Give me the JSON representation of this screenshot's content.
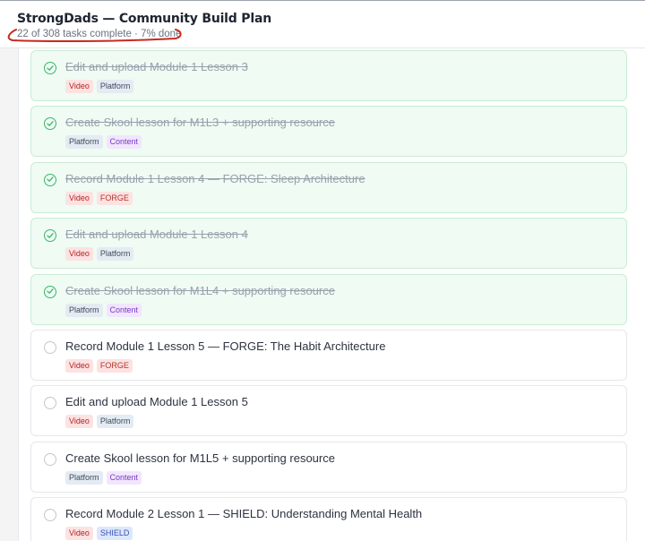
{
  "header": {
    "title": "StrongDads — Community Build Plan",
    "progress_text": "22 of 308 tasks complete · 7% done",
    "tasks_complete": 22,
    "tasks_total": 308,
    "percent_done": 7
  },
  "colors": {
    "done_background": "#effbf3",
    "check_green": "#3bb56c",
    "annotation_red": "#c62a1e"
  },
  "tasks": [
    {
      "title": "Edit and upload Module 1 Lesson 3",
      "done": true,
      "tags": [
        {
          "label": "Video",
          "kind": "video"
        },
        {
          "label": "Platform",
          "kind": "platform"
        }
      ]
    },
    {
      "title": "Create Skool lesson for M1L3 + supporting resource",
      "done": true,
      "tags": [
        {
          "label": "Platform",
          "kind": "platform"
        },
        {
          "label": "Content",
          "kind": "content"
        }
      ]
    },
    {
      "title": "Record Module 1 Lesson 4 — FORGE: Sleep Architecture",
      "done": true,
      "tags": [
        {
          "label": "Video",
          "kind": "video"
        },
        {
          "label": "FORGE",
          "kind": "forge"
        }
      ]
    },
    {
      "title": "Edit and upload Module 1 Lesson 4",
      "done": true,
      "tags": [
        {
          "label": "Video",
          "kind": "video"
        },
        {
          "label": "Platform",
          "kind": "platform"
        }
      ]
    },
    {
      "title": "Create Skool lesson for M1L4 + supporting resource",
      "done": true,
      "tags": [
        {
          "label": "Platform",
          "kind": "platform"
        },
        {
          "label": "Content",
          "kind": "content"
        }
      ]
    },
    {
      "title": "Record Module 1 Lesson 5 — FORGE: The Habit Architecture",
      "done": false,
      "tags": [
        {
          "label": "Video",
          "kind": "video"
        },
        {
          "label": "FORGE",
          "kind": "forge"
        }
      ]
    },
    {
      "title": "Edit and upload Module 1 Lesson 5",
      "done": false,
      "tags": [
        {
          "label": "Video",
          "kind": "video"
        },
        {
          "label": "Platform",
          "kind": "platform"
        }
      ]
    },
    {
      "title": "Create Skool lesson for M1L5 + supporting resource",
      "done": false,
      "tags": [
        {
          "label": "Platform",
          "kind": "platform"
        },
        {
          "label": "Content",
          "kind": "content"
        }
      ]
    },
    {
      "title": "Record Module 2 Lesson 1 — SHIELD: Understanding Mental Health",
      "done": false,
      "tags": [
        {
          "label": "Video",
          "kind": "video"
        },
        {
          "label": "SHIELD",
          "kind": "shield"
        }
      ]
    }
  ]
}
